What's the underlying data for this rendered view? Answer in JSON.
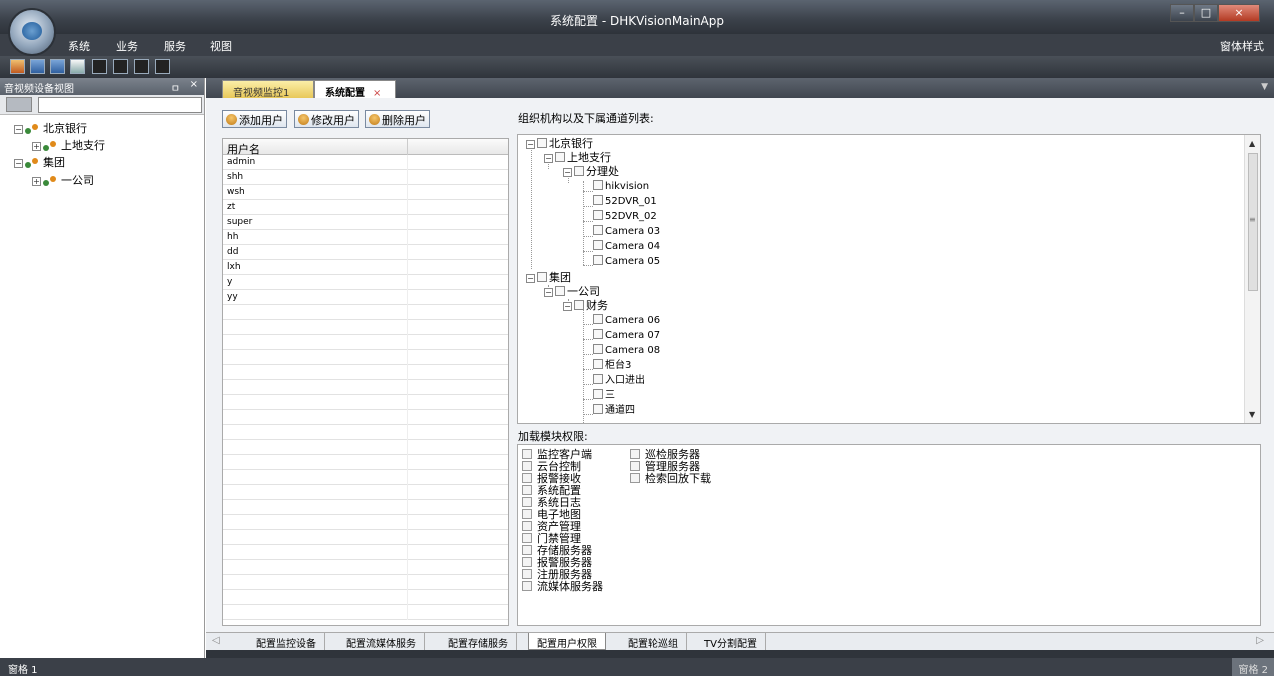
{
  "window": {
    "title": "系统配置 - DHKVisionMainApp"
  },
  "menu": {
    "items": [
      "系统",
      "业务",
      "服务",
      "视图"
    ],
    "style_label": "窗体样式"
  },
  "left_panel": {
    "title": "音视频设备视图",
    "pin": "ㅁ",
    "close": "×",
    "tree": [
      {
        "label": "北京银行",
        "level": 0
      },
      {
        "label": "上地支行",
        "level": 1
      },
      {
        "label": "集团",
        "level": 0
      },
      {
        "label": "一公司",
        "level": 1
      }
    ]
  },
  "tabs": [
    {
      "label": "音视频监控1",
      "active": false
    },
    {
      "label": "系统配置",
      "active": true,
      "close": "×"
    }
  ],
  "user_panel": {
    "buttons": [
      "添加用户",
      "修改用户",
      "删除用户"
    ],
    "column_header": "用户名",
    "users": [
      "admin",
      "shh",
      "wsh",
      "zt",
      "super",
      "hh",
      "dd",
      "lxh",
      "y",
      "yy"
    ]
  },
  "org_panel": {
    "label": "组织机构以及下属通道列表:",
    "nodes": [
      {
        "label": "北京银行"
      },
      {
        "label": "上地支行"
      },
      {
        "label": "分理处"
      },
      {
        "label": "hikvision"
      },
      {
        "label": "52DVR_01"
      },
      {
        "label": "52DVR_02"
      },
      {
        "label": "Camera 03"
      },
      {
        "label": "Camera 04"
      },
      {
        "label": "Camera 05"
      },
      {
        "label": "集团"
      },
      {
        "label": "一公司"
      },
      {
        "label": "财务"
      },
      {
        "label": "Camera 06"
      },
      {
        "label": "Camera 07"
      },
      {
        "label": "Camera 08"
      },
      {
        "label": "柜台3"
      },
      {
        "label": "入口进出"
      },
      {
        "label": "三"
      },
      {
        "label": "通道四"
      }
    ]
  },
  "perm_panel": {
    "label": "加载模块权限:",
    "col1": [
      "监控客户端",
      "云台控制",
      "报警接收",
      "系统配置",
      "系统日志",
      "电子地图",
      "资产管理",
      "门禁管理",
      "存储服务器",
      "报警服务器",
      "注册服务器",
      "流媒体服务器"
    ],
    "col2": [
      "巡检服务器",
      "管理服务器",
      "检索回放下载"
    ]
  },
  "bottom_tabs": [
    {
      "label": "配置监控设备",
      "active": false
    },
    {
      "label": "配置流媒体服务",
      "active": false
    },
    {
      "label": "配置存储服务",
      "active": false
    },
    {
      "label": "配置用户权限",
      "active": true
    },
    {
      "label": "配置轮巡组",
      "active": false
    },
    {
      "label": "TV分割配置",
      "active": false
    }
  ],
  "status": {
    "left": "窗格 1",
    "right": "窗格 2"
  },
  "colors": {
    "accent": "#e8c85a",
    "chrome": "#3b4048"
  }
}
